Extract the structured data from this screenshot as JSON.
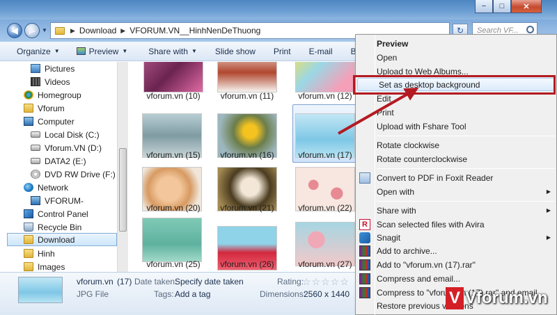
{
  "window": {
    "controls": {
      "minimize": "−",
      "maximize": "□",
      "close": "✕"
    }
  },
  "address": {
    "crumbs": [
      "Download",
      "VFORUM.VN__HinhNenDeThuong"
    ],
    "search_placeholder": "Search VF..."
  },
  "toolbar": {
    "items": [
      {
        "label": "Organize",
        "dropdown": true
      },
      {
        "label": "Preview",
        "dropdown": true,
        "icon": "preview-icon"
      },
      {
        "label": "Share with",
        "dropdown": true
      },
      {
        "label": "Slide show"
      },
      {
        "label": "Print"
      },
      {
        "label": "E-mail"
      },
      {
        "label": "Burn"
      }
    ]
  },
  "nav": {
    "items": [
      {
        "label": "Pictures",
        "icon": "pictures-icon"
      },
      {
        "label": "Videos",
        "icon": "videos-icon"
      },
      {
        "label": "Homegroup",
        "icon": "homegroup-icon"
      },
      {
        "label": "Vforum",
        "icon": "folder-icon"
      },
      {
        "label": "Computer",
        "icon": "computer-icon"
      },
      {
        "label": "Local Disk (C:)",
        "icon": "drive-icon"
      },
      {
        "label": "Vforum.VN (D:)",
        "icon": "drive-icon"
      },
      {
        "label": "DATA2 (E:)",
        "icon": "drive-icon"
      },
      {
        "label": "DVD RW Drive (F:)",
        "icon": "dvd-icon"
      },
      {
        "label": "Network",
        "icon": "network-icon"
      },
      {
        "label": "VFORUM-",
        "icon": "computer-icon"
      },
      {
        "label": "Control Panel",
        "icon": "control-panel-icon"
      },
      {
        "label": "Recycle Bin",
        "icon": "recycle-bin-icon"
      },
      {
        "label": "Download",
        "icon": "folder-icon",
        "selected": true
      },
      {
        "label": "Hinh",
        "icon": "folder-icon"
      },
      {
        "label": "Images",
        "icon": "folder-icon"
      }
    ]
  },
  "files": {
    "items": [
      {
        "label": "vforum.vn  (10)"
      },
      {
        "label": "vforum.vn  (11)"
      },
      {
        "label": "vforum.vn  (12)"
      },
      {
        "label": "vforum.vn  (15)"
      },
      {
        "label": "vforum.vn  (16)"
      },
      {
        "label": "vforum.vn  (17)",
        "selected": true
      },
      {
        "label": "vforum.vn  (20)"
      },
      {
        "label": "vforum.vn  (21)"
      },
      {
        "label": "vforum.vn  (22)"
      },
      {
        "label": "vforum.vn  (25)"
      },
      {
        "label": "vforum.vn  (26)"
      },
      {
        "label": "vforum.vn  (27)"
      }
    ]
  },
  "details": {
    "name": "vforum.vn",
    "index": "(17)",
    "type": "JPG File",
    "date_label": "Date taken:",
    "date_value": "Specify date taken",
    "tags_label": "Tags:",
    "tags_value": "Add a tag",
    "rating_label": "Rating:",
    "rating_stars": "☆☆☆☆☆",
    "rating_value": 0,
    "dimensions_label": "Dimensions:",
    "dimensions_value": "2560 x 1440"
  },
  "context_menu": {
    "items": [
      {
        "label": "Preview",
        "bold": true
      },
      {
        "label": "Open"
      },
      {
        "label": "Upload to Web Albums..."
      },
      {
        "label": "Set as desktop background",
        "highlighted": true
      },
      {
        "label": "Edit"
      },
      {
        "label": "Print"
      },
      {
        "label": "Upload with Fshare Tool"
      },
      {
        "label": "Rotate clockwise"
      },
      {
        "label": "Rotate counterclockwise"
      },
      {
        "label": "Convert to PDF in Foxit Reader"
      },
      {
        "label": "Open with",
        "submenu": true
      },
      {
        "label": "Share with",
        "submenu": true
      },
      {
        "label": "Scan selected files with Avira",
        "icon": "avira-icon"
      },
      {
        "label": "Snagit",
        "submenu": true,
        "icon": "snagit-icon"
      },
      {
        "label": "Add to archive...",
        "icon": "winrar-icon"
      },
      {
        "label": "Add to \"vforum.vn  (17).rar\"",
        "icon": "winrar-icon"
      },
      {
        "label": "Compress and email...",
        "icon": "winrar-icon"
      },
      {
        "label": "Compress to \"vforum.vn  (17).rar\" and email",
        "icon": "winrar-icon"
      },
      {
        "label": "Restore previous versions"
      }
    ],
    "submenu_glyph": "▶"
  },
  "watermark": {
    "mark": "V",
    "text": "Vforum.vn",
    "color": "#d51f26"
  },
  "colors": {
    "highlight_box": "#b31a21",
    "arrow": "#b31a21"
  }
}
